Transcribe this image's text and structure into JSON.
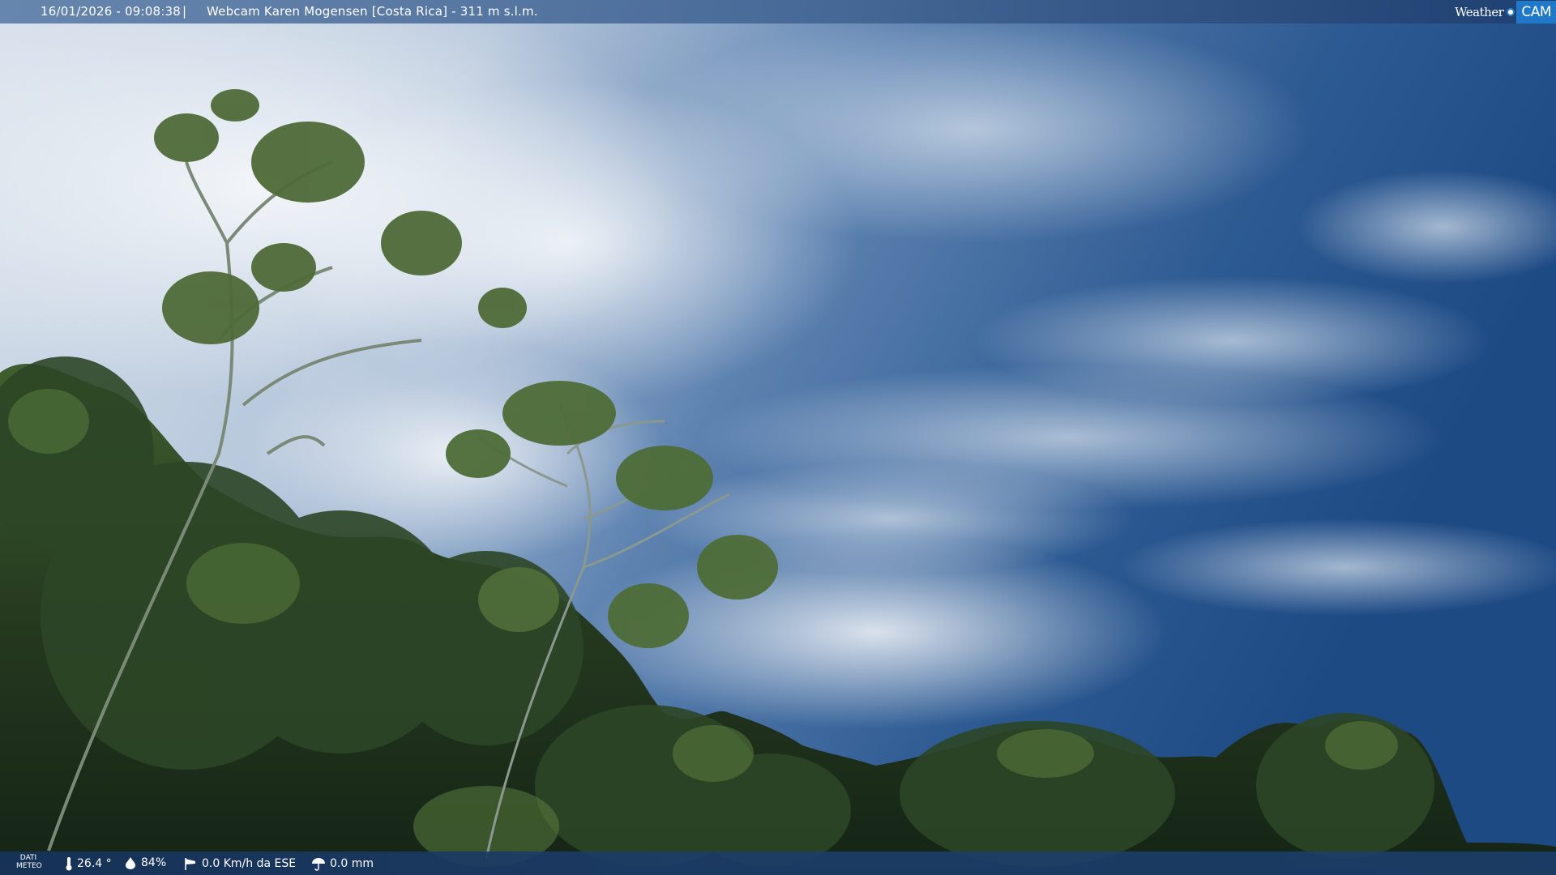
{
  "header": {
    "datetime": "16/01/2026 - 09:08:38",
    "separator": "|",
    "title": "Webcam Karen Mogensen [Costa Rica] - 311 m s.l.m.",
    "brand_weather": "Weather",
    "brand_cam": "CAM"
  },
  "footer": {
    "label_line1": "DATI",
    "label_line2": "METEO",
    "temperature": "26.4 °",
    "humidity": "84%",
    "wind": "0.0 Km/h da ESE",
    "rain": "0.0 mm"
  },
  "icons": {
    "temperature": "thermometer-icon",
    "humidity": "droplet-icon",
    "wind": "windsock-icon",
    "rain": "umbrella-icon"
  },
  "colors": {
    "sky_light": "#e8eef4",
    "sky_blue": "#2e5c94",
    "sky_deep": "#1f4a82",
    "foliage_dark": "#1e2f1c",
    "foliage_mid": "#3c5a2e",
    "bar": "#1d3f6e",
    "brand_blue": "#1f78c8"
  }
}
